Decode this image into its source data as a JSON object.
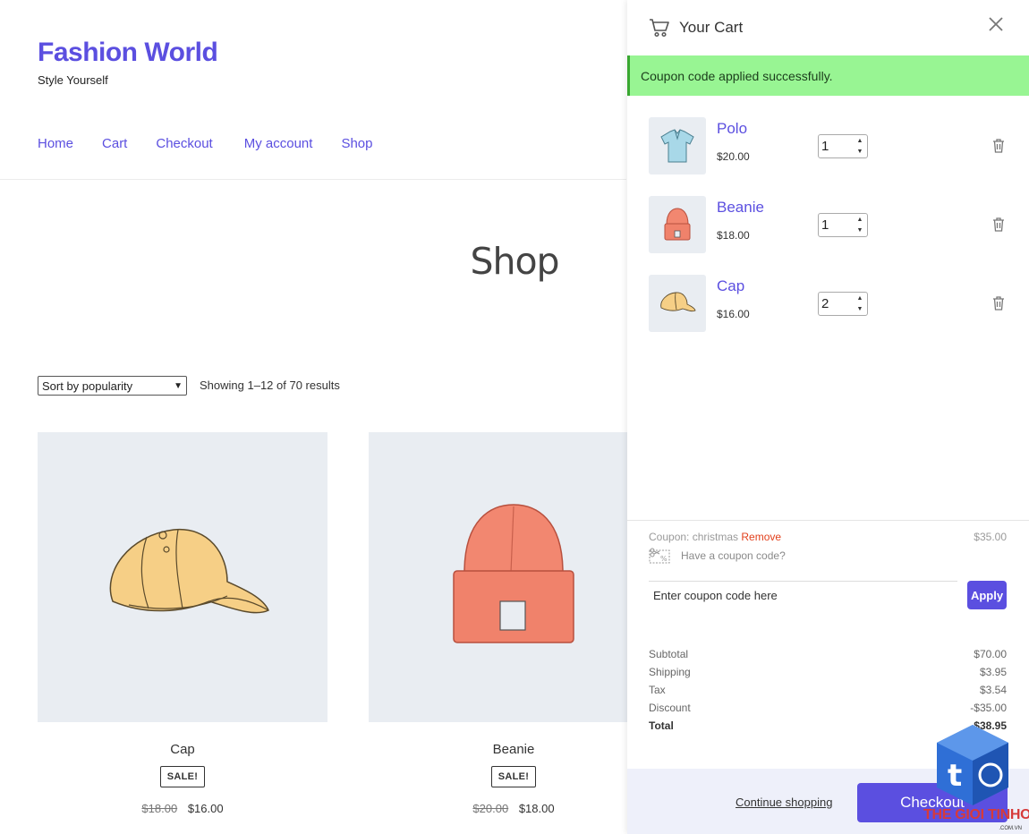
{
  "site": {
    "title": "Fashion World",
    "tagline": "Style Yourself",
    "nav": [
      "Home",
      "Cart",
      "Checkout",
      "My account",
      "Shop"
    ]
  },
  "shop": {
    "page_title": "Shop",
    "sort_value": "Sort by popularity",
    "result_count": "Showing 1–12 of 70 results",
    "products": [
      {
        "name": "Cap",
        "badge": "SALE!",
        "old_price": "$18.00",
        "price": "$16.00"
      },
      {
        "name": "Beanie",
        "badge": "SALE!",
        "old_price": "$20.00",
        "price": "$18.00"
      }
    ]
  },
  "cart": {
    "title": "Your Cart",
    "notice": "Coupon code applied successfully.",
    "items": [
      {
        "name": "Polo",
        "price": "$20.00",
        "qty": "1",
        "icon": "polo-shirt"
      },
      {
        "name": "Beanie",
        "price": "$18.00",
        "qty": "1",
        "icon": "beanie"
      },
      {
        "name": "Cap",
        "price": "$16.00",
        "qty": "2",
        "icon": "cap"
      }
    ],
    "coupon": {
      "label": "Coupon: christmas",
      "remove": "Remove",
      "amount": "$35.00",
      "toggle": "Have a coupon code?",
      "placeholder": "Enter coupon code here",
      "apply": "Apply"
    },
    "totals": [
      {
        "label": "Subtotal",
        "value": "$70.00"
      },
      {
        "label": "Shipping",
        "value": "$3.95"
      },
      {
        "label": "Tax",
        "value": "$3.54"
      },
      {
        "label": "Discount",
        "value": "-$35.00"
      },
      {
        "label": "Total",
        "value": "$38.95"
      }
    ],
    "continue": "Continue shopping",
    "checkout": "Checkout"
  },
  "watermark": {
    "text": "THE GIOI TINHOC",
    "sub": ".COM.VN"
  },
  "colors": {
    "accent": "#5b4fe0",
    "notice_bg": "#98f593",
    "remove": "#e2401c",
    "thumb_bg": "#e9edf2"
  }
}
